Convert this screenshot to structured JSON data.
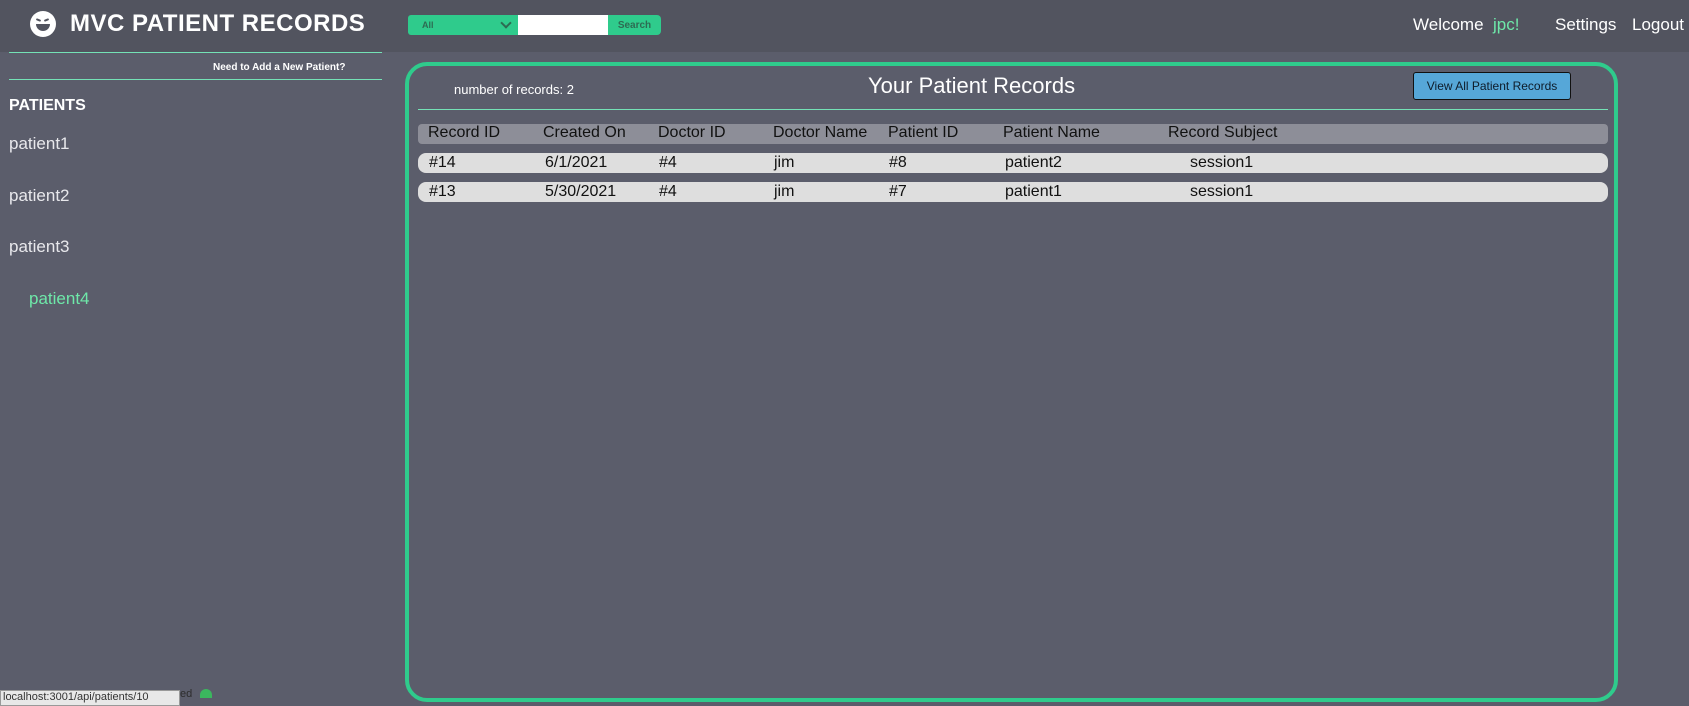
{
  "header": {
    "title": "MVC PATIENT RECORDS",
    "search": {
      "category": "All",
      "button_label": "Search",
      "query": ""
    },
    "welcome_label": "Welcome",
    "username": "jpc!",
    "settings_label": "Settings",
    "logout_label": "Logout"
  },
  "sidebar": {
    "add_patient_label": "Need to Add a New Patient?",
    "heading": "PATIENTS",
    "patients": [
      {
        "label": "patient1",
        "active": false
      },
      {
        "label": "patient2",
        "active": false
      },
      {
        "label": "patient3",
        "active": false
      },
      {
        "label": "patient4",
        "active": true
      }
    ]
  },
  "main": {
    "record_count_label": "number of records: 2",
    "title": "Your Patient Records",
    "view_all_label": "View All Patient Records",
    "columns": [
      "Record ID",
      "Created On",
      "Doctor ID",
      "Doctor Name",
      "Patient ID",
      "Patient Name",
      "Record Subject"
    ],
    "rows": [
      [
        "#14",
        "6/1/2021",
        "#4",
        "jim",
        "#8",
        "patient2",
        "session1"
      ],
      [
        "#13",
        "5/30/2021",
        "#4",
        "jim",
        "#7",
        "patient1",
        "session1"
      ]
    ]
  },
  "status_bar": {
    "url": "localhost:3001/api/patients/10",
    "footer_text": "ed"
  },
  "colors": {
    "accent": "#2fcb8c",
    "username": "#6ee8a9",
    "button": "#56a7d8",
    "background": "#5b5d6b"
  }
}
